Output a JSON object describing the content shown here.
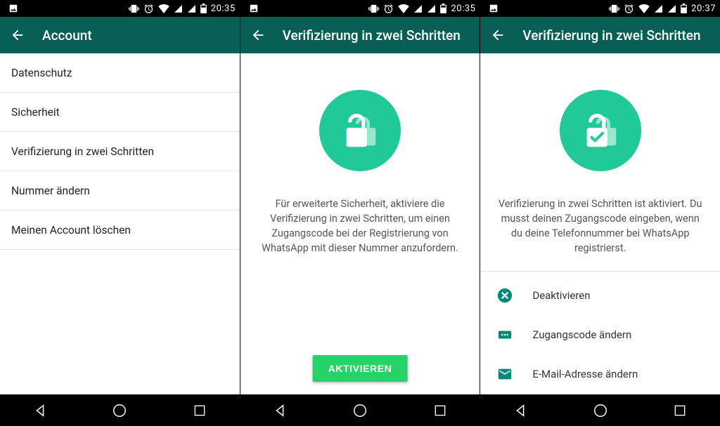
{
  "accent": "#075E54",
  "actionGreen": "#25D366",
  "iconTeal": "#00897B",
  "screens": [
    {
      "time": "20:35",
      "title": "Account",
      "items": [
        "Datenschutz",
        "Sicherheit",
        "Verifizierung in zwei Schritten",
        "Nummer ändern",
        "Meinen Account löschen"
      ]
    },
    {
      "time": "20:35",
      "title": "Verifizierung in zwei Schritten",
      "blurb": "Für erweiterte Sicherheit, aktiviere die Verifizierung in zwei Schritten, um einen Zugangscode bei der Registrierung von WhatsApp mit dieser Nummer anzufordern.",
      "button": "AKTIVIEREN"
    },
    {
      "time": "20:37",
      "title": "Verifizierung in zwei Schritten",
      "blurb": "Verifizierung in zwei Schritten ist aktiviert. Du musst deinen Zugangscode eingeben, wenn du deine Telefonnummer bei WhatsApp registrierst.",
      "options": [
        "Deaktivieren",
        "Zugangscode ändern",
        "E-Mail-Adresse ändern"
      ]
    }
  ]
}
